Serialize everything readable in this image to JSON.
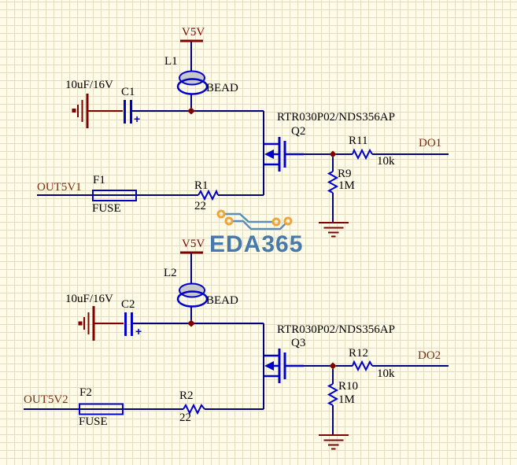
{
  "colors": {
    "background": "#FEFCE8",
    "grid_line": "#E2DCC2",
    "wire": "#00007B",
    "component": "#0000C8",
    "power": "#800000",
    "net_label": "#7B2D10",
    "designator_text": "#000000",
    "bead_fill": "#C8C8CE",
    "watermark_text": "#4679AC",
    "watermark_trace": "#5B8FB5",
    "watermark_pad": "#F0A43C"
  },
  "watermark": {
    "brand": "EDA365"
  },
  "circuits": [
    {
      "power_port": "V5V",
      "inductor_ref": "L1",
      "inductor_value": "BEAD",
      "cap_value": "10uF/16V",
      "cap_ref": "C1",
      "cap_polarity": "+",
      "input_net": "OUT5V1",
      "fuse_ref": "F1",
      "fuse_value": "FUSE",
      "res_ref": "R1",
      "res_value": "22",
      "mosfet_part": "RTR030P02/NDS356AP",
      "mosfet_ref": "Q2",
      "out_res_ref": "R11",
      "out_res_value": "10k",
      "pulldown_ref": "R9",
      "pulldown_value": "1M",
      "output_net": "DO1"
    },
    {
      "power_port": "V5V",
      "inductor_ref": "L2",
      "inductor_value": "BEAD",
      "cap_value": "10uF/16V",
      "cap_ref": "C2",
      "cap_polarity": "+",
      "input_net": "OUT5V2",
      "fuse_ref": "F2",
      "fuse_value": "FUSE",
      "res_ref": "R2",
      "res_value": "22",
      "mosfet_part": "RTR030P02/NDS356AP",
      "mosfet_ref": "Q3",
      "out_res_ref": "R12",
      "out_res_value": "10k",
      "pulldown_ref": "R10",
      "pulldown_value": "1M",
      "output_net": "DO2"
    }
  ]
}
